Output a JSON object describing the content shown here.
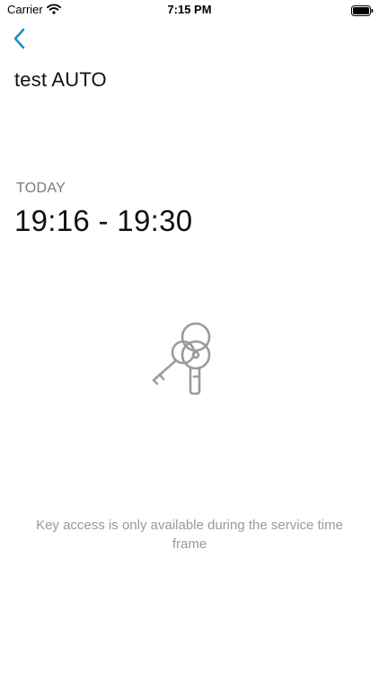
{
  "status_bar": {
    "carrier": "Carrier",
    "time": "7:15 PM"
  },
  "header": {
    "title": "test AUTO",
    "back_icon": "chevron-left-icon"
  },
  "schedule": {
    "day_label": "TODAY",
    "time_range": "19:16 - 19:30"
  },
  "illustration": {
    "icon": "keys-icon"
  },
  "message": {
    "text": "Key access is only available during the service time frame"
  },
  "colors": {
    "accent": "#1a8fc9",
    "muted_text": "#9a9a9a",
    "label_text": "#7a7a7a",
    "icon_stroke": "#9b9b9b"
  }
}
